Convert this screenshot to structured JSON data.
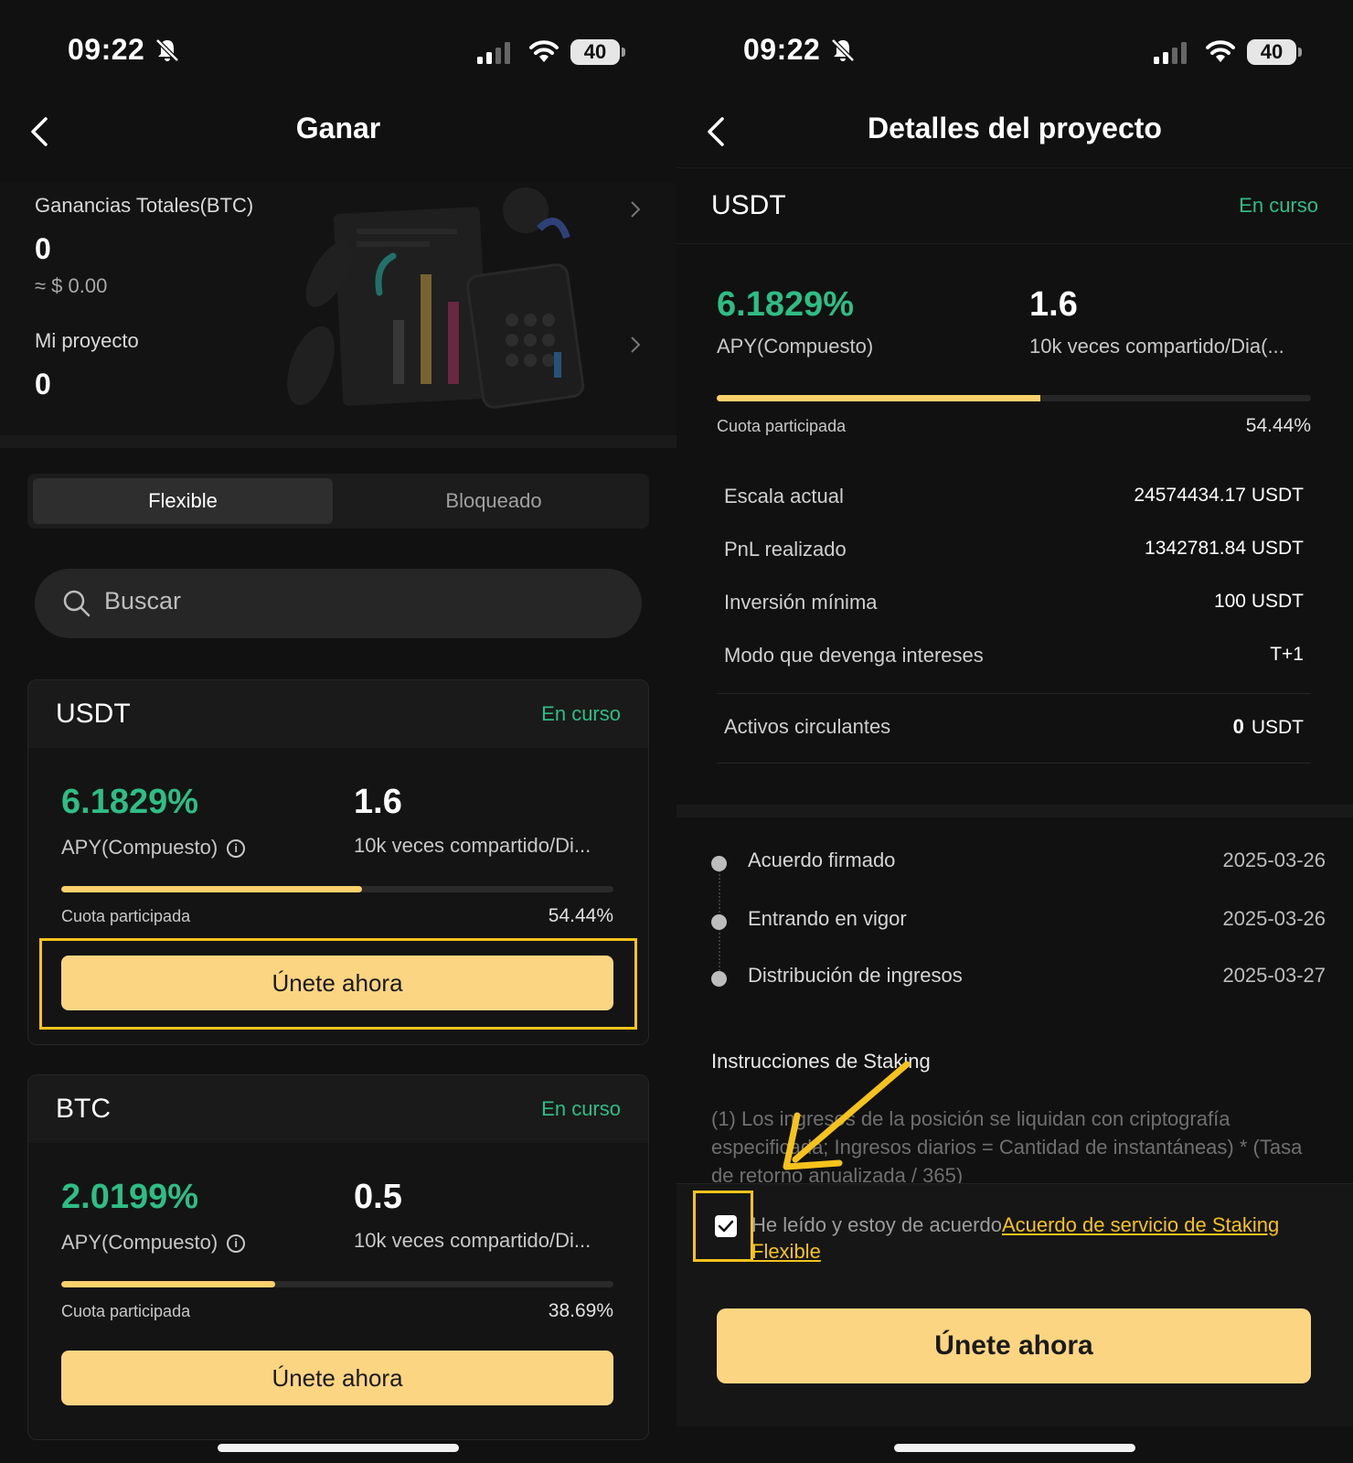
{
  "status_bar": {
    "time": "09:22",
    "battery": "40"
  },
  "left": {
    "nav_title": "Ganar",
    "total_label": "Ganancias Totales(BTC)",
    "total_value": "0",
    "total_usd": "≈ $ 0.00",
    "project_label": "Mi proyecto",
    "project_value": "0",
    "tabs": [
      "Flexible",
      "Bloqueado"
    ],
    "search_placeholder": "Buscar",
    "cards": [
      {
        "coin": "USDT",
        "status": "En curso",
        "apy": "6.1829%",
        "apy_label": "APY(Compuesto)",
        "multiplier": "1.6",
        "multiplier_label": "10k veces compartido/Di...",
        "quota_label": "Cuota participada",
        "quota_value": "54.44%",
        "quota_fraction": 0.5444,
        "button": "Únete ahora"
      },
      {
        "coin": "BTC",
        "status": "En curso",
        "apy": "2.0199%",
        "apy_label": "APY(Compuesto)",
        "multiplier": "0.5",
        "multiplier_label": "10k veces compartido/Di...",
        "quota_label": "Cuota participada",
        "quota_value": "38.69%",
        "quota_fraction": 0.3869,
        "button": "Únete ahora"
      }
    ]
  },
  "right": {
    "nav_title": "Detalles del proyecto",
    "coin": "USDT",
    "status": "En curso",
    "apy": "6.1829%",
    "apy_label": "APY(Compuesto)",
    "multiplier": "1.6",
    "multiplier_label": "10k veces compartido/Dia(...",
    "quota_label": "Cuota participada",
    "quota_value": "54.44%",
    "quota_fraction": 0.5444,
    "details": [
      {
        "key": "Escala actual",
        "value": "24574434.17 USDT"
      },
      {
        "key": "PnL realizado",
        "value": "1342781.84 USDT"
      },
      {
        "key": "Inversión mínima",
        "value": "100 USDT"
      },
      {
        "key": "Modo que devenga intereses",
        "value": "T+1"
      }
    ],
    "circulating_label": "Activos circulantes",
    "circulating_amount": "0",
    "circulating_unit": "USDT",
    "timeline": [
      {
        "label": "Acuerdo firmado",
        "date": "2025-03-26"
      },
      {
        "label": "Entrando en vigor",
        "date": "2025-03-26"
      },
      {
        "label": "Distribución de ingresos",
        "date": "2025-03-27"
      }
    ],
    "instructions_title": "Instrucciones de Staking",
    "instructions_text": "(1) Los ingresos de la posición se liquidan con criptografía especificada; Ingresos diarios = Cantidad de instantáneas) * (Tasa de retorno anualizada / 365)",
    "agree_text": "He leído y estoy de acuerdo",
    "agree_link": "Acuerdo de servicio de Staking Flexible",
    "checkbox_checked": true,
    "button": "Únete ahora"
  },
  "colors": {
    "accent_green": "#2ebd85",
    "accent_yellow": "#fcd582",
    "highlight": "#f6c21c",
    "background": "#111111"
  }
}
